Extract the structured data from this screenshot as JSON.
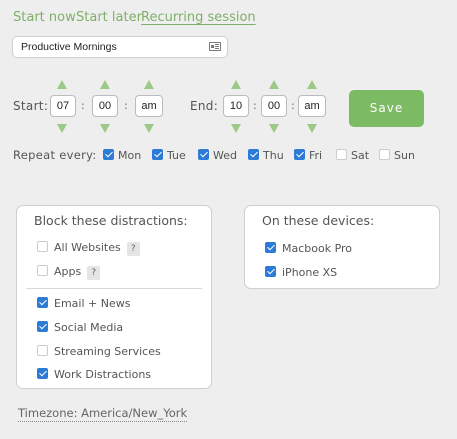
{
  "tabs": [
    {
      "label": "Start now"
    },
    {
      "label": "Start later"
    },
    {
      "label": "Recurring session"
    }
  ],
  "session_name": {
    "value": "Productive Mornings"
  },
  "start": {
    "label": "Start:",
    "hour": "07",
    "minute": "00",
    "ampm": "am"
  },
  "end": {
    "label": "End:",
    "hour": "10",
    "minute": "00",
    "ampm": "am"
  },
  "time_separator": ":",
  "save_label": "Save",
  "repeat": {
    "label": "Repeat every:",
    "days": [
      {
        "label": "Mon",
        "checked": true
      },
      {
        "label": "Tue",
        "checked": true
      },
      {
        "label": "Wed",
        "checked": true
      },
      {
        "label": "Thu",
        "checked": true
      },
      {
        "label": "Fri",
        "checked": true
      },
      {
        "label": "Sat",
        "checked": false
      },
      {
        "label": "Sun",
        "checked": false
      }
    ]
  },
  "distractions": {
    "title": "Block these distractions:",
    "help_label": "?",
    "items": [
      {
        "label": "All Websites",
        "checked": false
      },
      {
        "label": "Apps",
        "checked": false
      },
      {
        "label": "Email + News",
        "checked": true
      },
      {
        "label": "Social Media",
        "checked": true
      },
      {
        "label": "Streaming Services",
        "checked": false
      },
      {
        "label": "Work Distractions",
        "checked": true
      }
    ]
  },
  "devices": {
    "title": "On these devices:",
    "items": [
      {
        "label": "Macbook Pro",
        "checked": true
      },
      {
        "label": "iPhone XS",
        "checked": true
      }
    ]
  },
  "timezone": {
    "text": "Timezone: America/New_York"
  },
  "colors": {
    "accent": "#7cbb64",
    "link": "#7fb069",
    "checkbox": "#2e7bd6",
    "background": "#eeeeee"
  }
}
